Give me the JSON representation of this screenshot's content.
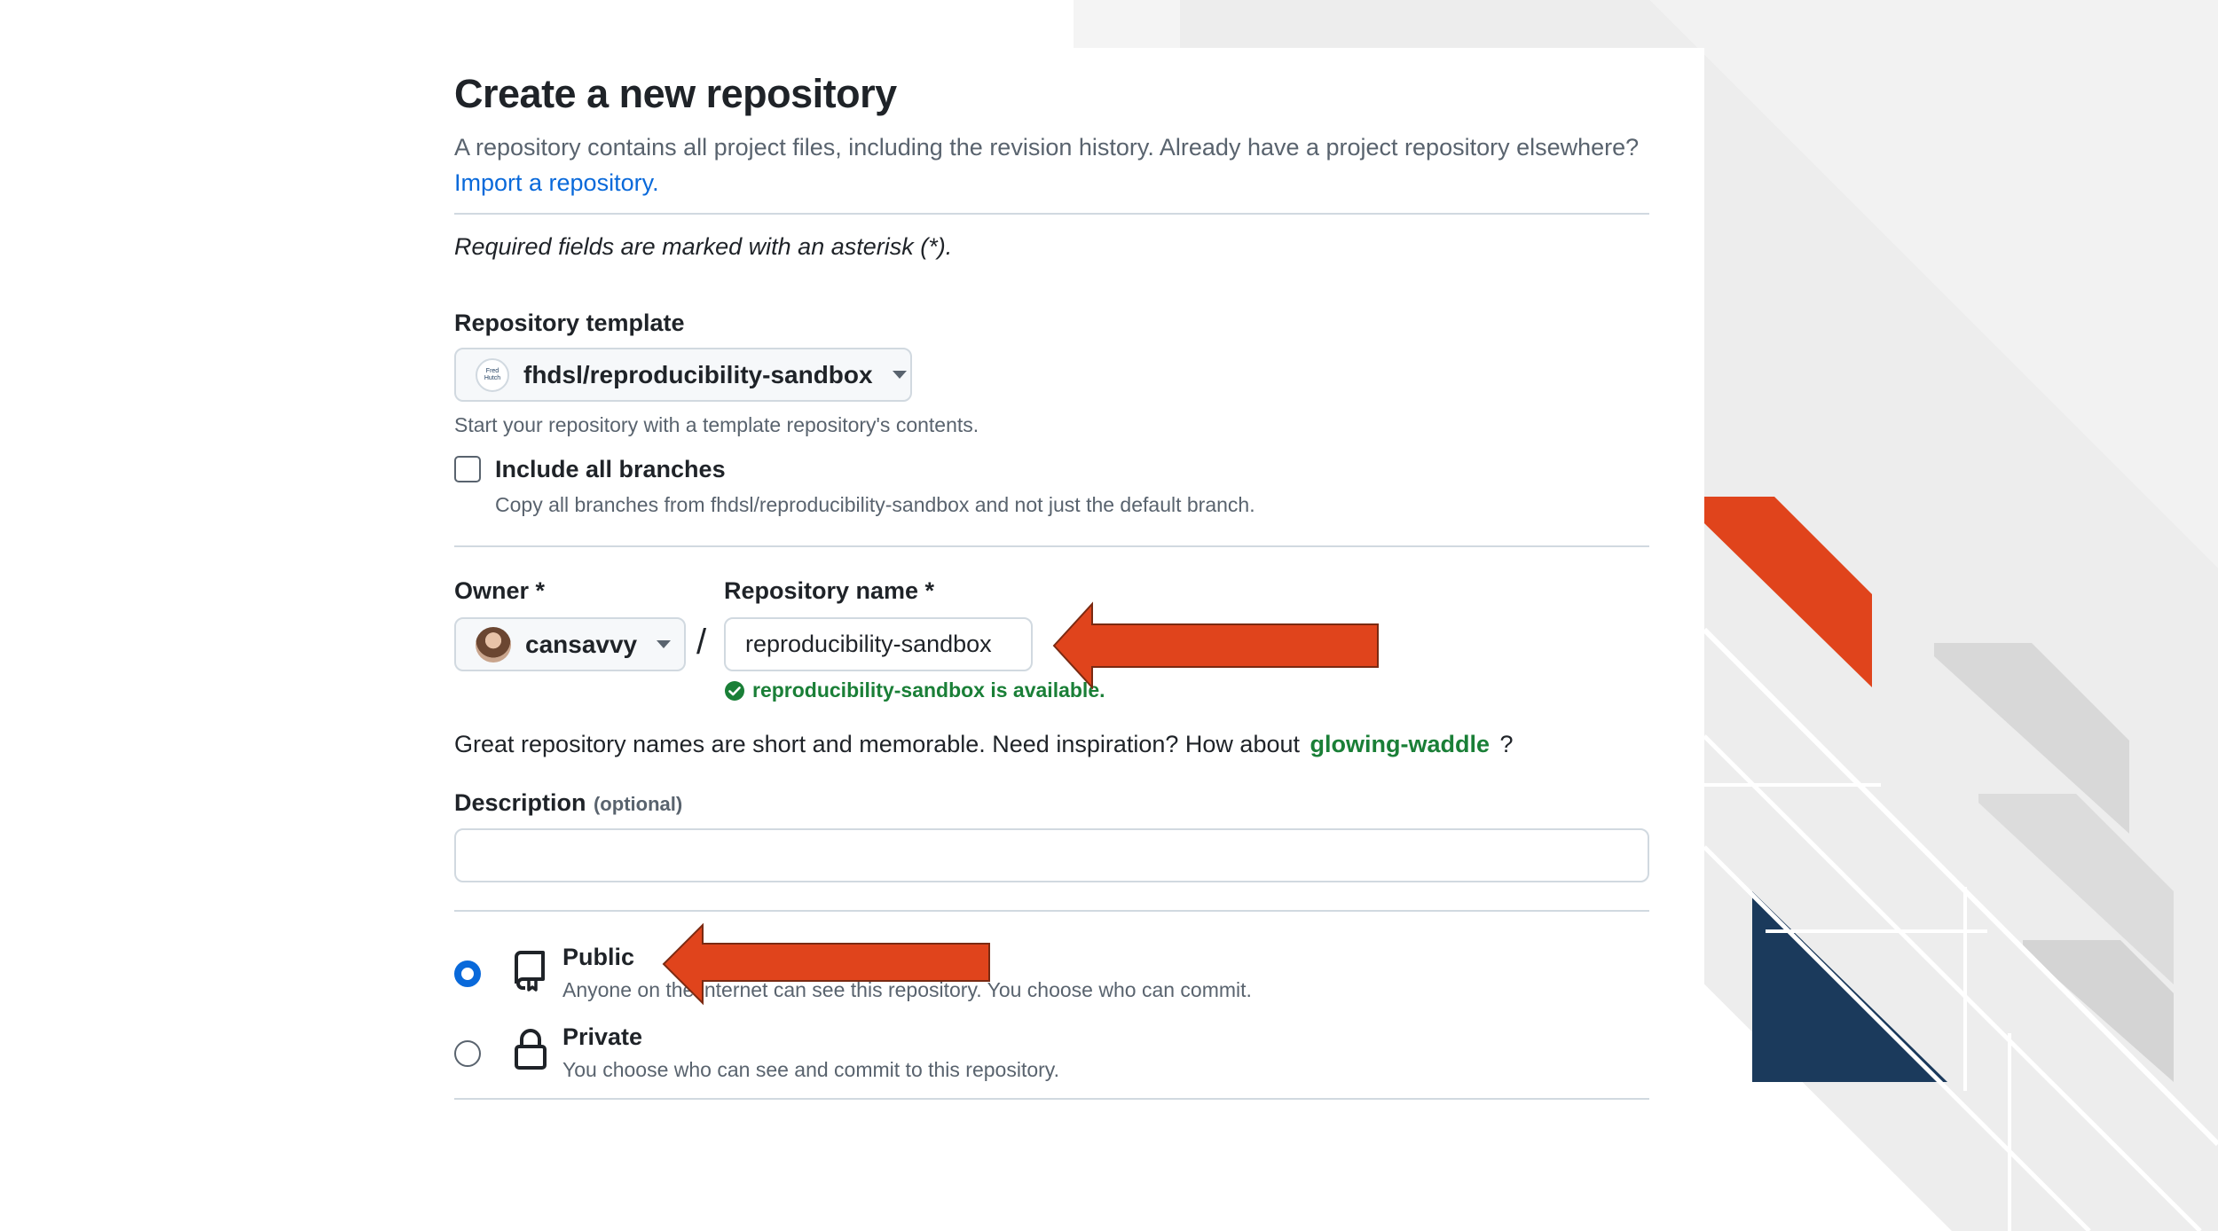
{
  "page": {
    "title": "Create a new repository",
    "intro": "A repository contains all project files, including the revision history. Already have a project repository elsewhere?",
    "import_link": "Import a repository.",
    "required_note": "Required fields are marked with an asterisk (*)."
  },
  "template": {
    "label": "Repository template",
    "selected": "fhdsl/reproducibility-sandbox",
    "avatar_text": "Fred Hutch",
    "help": "Start your repository with a template repository's contents.",
    "include_branches_label": "Include all branches",
    "include_branches_checked": false,
    "include_branches_help": "Copy all branches from fhdsl/reproducibility-sandbox and not just the default branch."
  },
  "owner": {
    "label": "Owner *",
    "selected": "cansavvy"
  },
  "separator": "/",
  "repo_name": {
    "label": "Repository name *",
    "value": "reproducibility-sandbox",
    "availability": "reproducibility-sandbox is available."
  },
  "suggestion": {
    "text": "Great repository names are short and memorable. Need inspiration? How about",
    "name": "glowing-waddle",
    "suffix": "?"
  },
  "description": {
    "label": "Description",
    "optional": "(optional)",
    "value": ""
  },
  "visibility": {
    "selected": "public",
    "public": {
      "label": "Public",
      "help": "Anyone on the internet can see this repository. You choose who can commit."
    },
    "private": {
      "label": "Private",
      "help": "You choose who can see and commit to this repository."
    }
  },
  "colors": {
    "arrow": "#e0441c",
    "navy": "#1b3a5c",
    "accent_blue": "#0969da",
    "success_green": "#1a7f37",
    "background_gray": "#ececec"
  },
  "icons": {
    "repo": "repo-icon",
    "lock": "lock-icon",
    "check": "check-circle-icon",
    "caret": "caret-down-icon"
  }
}
